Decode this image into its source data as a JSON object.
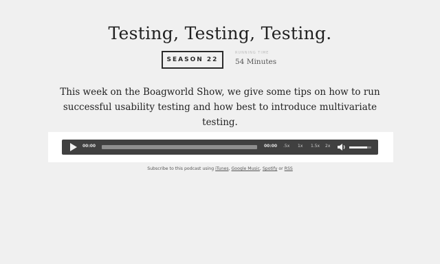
{
  "episode": {
    "title": "Testing, Testing, Testing.",
    "season_label": "SEASON 22",
    "running_time_label": "RUNNING TIME",
    "running_time_value": "54 Minutes",
    "description": "This week on the Boagworld Show, we give some tips on how to run successful usability testing and how best to introduce multivariate testing."
  },
  "player": {
    "current_time": "00:00",
    "total_time": "00:00",
    "progress": 0,
    "speeds": [
      ".5x",
      "1x",
      "1.5x",
      "2x"
    ],
    "volume_level": 0.8,
    "icons": {
      "play": "play-icon",
      "volume": "speaker-icon"
    }
  },
  "subscribe": {
    "prefix": "Subscribe to this podcast using ",
    "itunes": "iTunes",
    "sep1": ", ",
    "google": "Google Music",
    "sep2": ", ",
    "spotify": "Spotify",
    "sep3": " or ",
    "rss": "RSS"
  },
  "colors": {
    "background": "#f0f0f0",
    "player_bg": "#404040",
    "player_wrap_bg": "#ffffff"
  }
}
